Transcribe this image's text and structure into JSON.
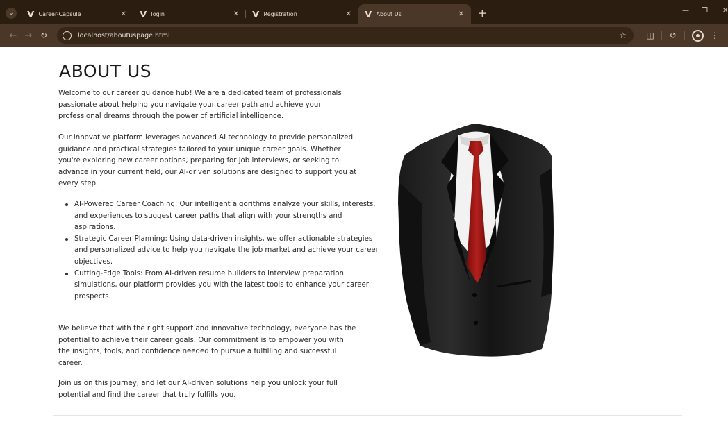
{
  "browser": {
    "tabs": [
      {
        "label": "Career-Capsule",
        "active": false
      },
      {
        "label": "login",
        "active": false
      },
      {
        "label": "Registration",
        "active": false
      },
      {
        "label": "About Us",
        "active": true
      }
    ],
    "url": "localhost/aboutuspage.html",
    "icons": {
      "tab_menu": "chevron-down-icon",
      "favicon": "v-logo-icon",
      "close": "close-icon",
      "new_tab": "plus-icon",
      "back": "back-arrow-icon",
      "forward": "forward-arrow-icon",
      "reload": "reload-icon",
      "site_info": "info-icon",
      "bookmark": "star-icon",
      "extensions": "puzzle-icon",
      "history": "history-icon",
      "profile": "profile-icon",
      "menu": "kebab-menu-icon"
    },
    "colors": {
      "frame": "#2b1d10",
      "toolbar": "#4b3727",
      "omnibox": "#362618"
    }
  },
  "page": {
    "title": "ABOUT US",
    "intro": "Welcome to our career guidance hub! We are a dedicated team of professionals passionate about helping you navigate your career path and achieve your professional dreams through the power of artificial intelligence.",
    "platform": "Our innovative platform leverages advanced AI technology to provide personalized guidance and practical strategies tailored to your unique career goals. Whether you're exploring new career options, preparing for job interviews, or seeking to advance in your current field, our AI-driven solutions are designed to support you at every step.",
    "features": [
      "AI-Powered Career Coaching: Our intelligent algorithms analyze your skills, interests, and experiences to suggest career paths that align with your strengths and aspirations.",
      "Strategic Career Planning: Using data-driven insights, we offer actionable strategies and personalized advice to help you navigate the job market and achieve your career objectives.",
      "Cutting-Edge Tools: From AI-driven resume builders to interview preparation simulations, our platform provides you with the latest tools to enhance your career prospects."
    ],
    "belief": "We believe that with the right support and innovative technology, everyone has the potential to achieve their career goals. Our commitment is to empower you with the insights, tools, and confidence needed to pursue a fulfilling and successful career.",
    "closing": "Join us on this journey, and let our AI-driven solutions help you unlock your full potential and find the career that truly fulfills you."
  }
}
